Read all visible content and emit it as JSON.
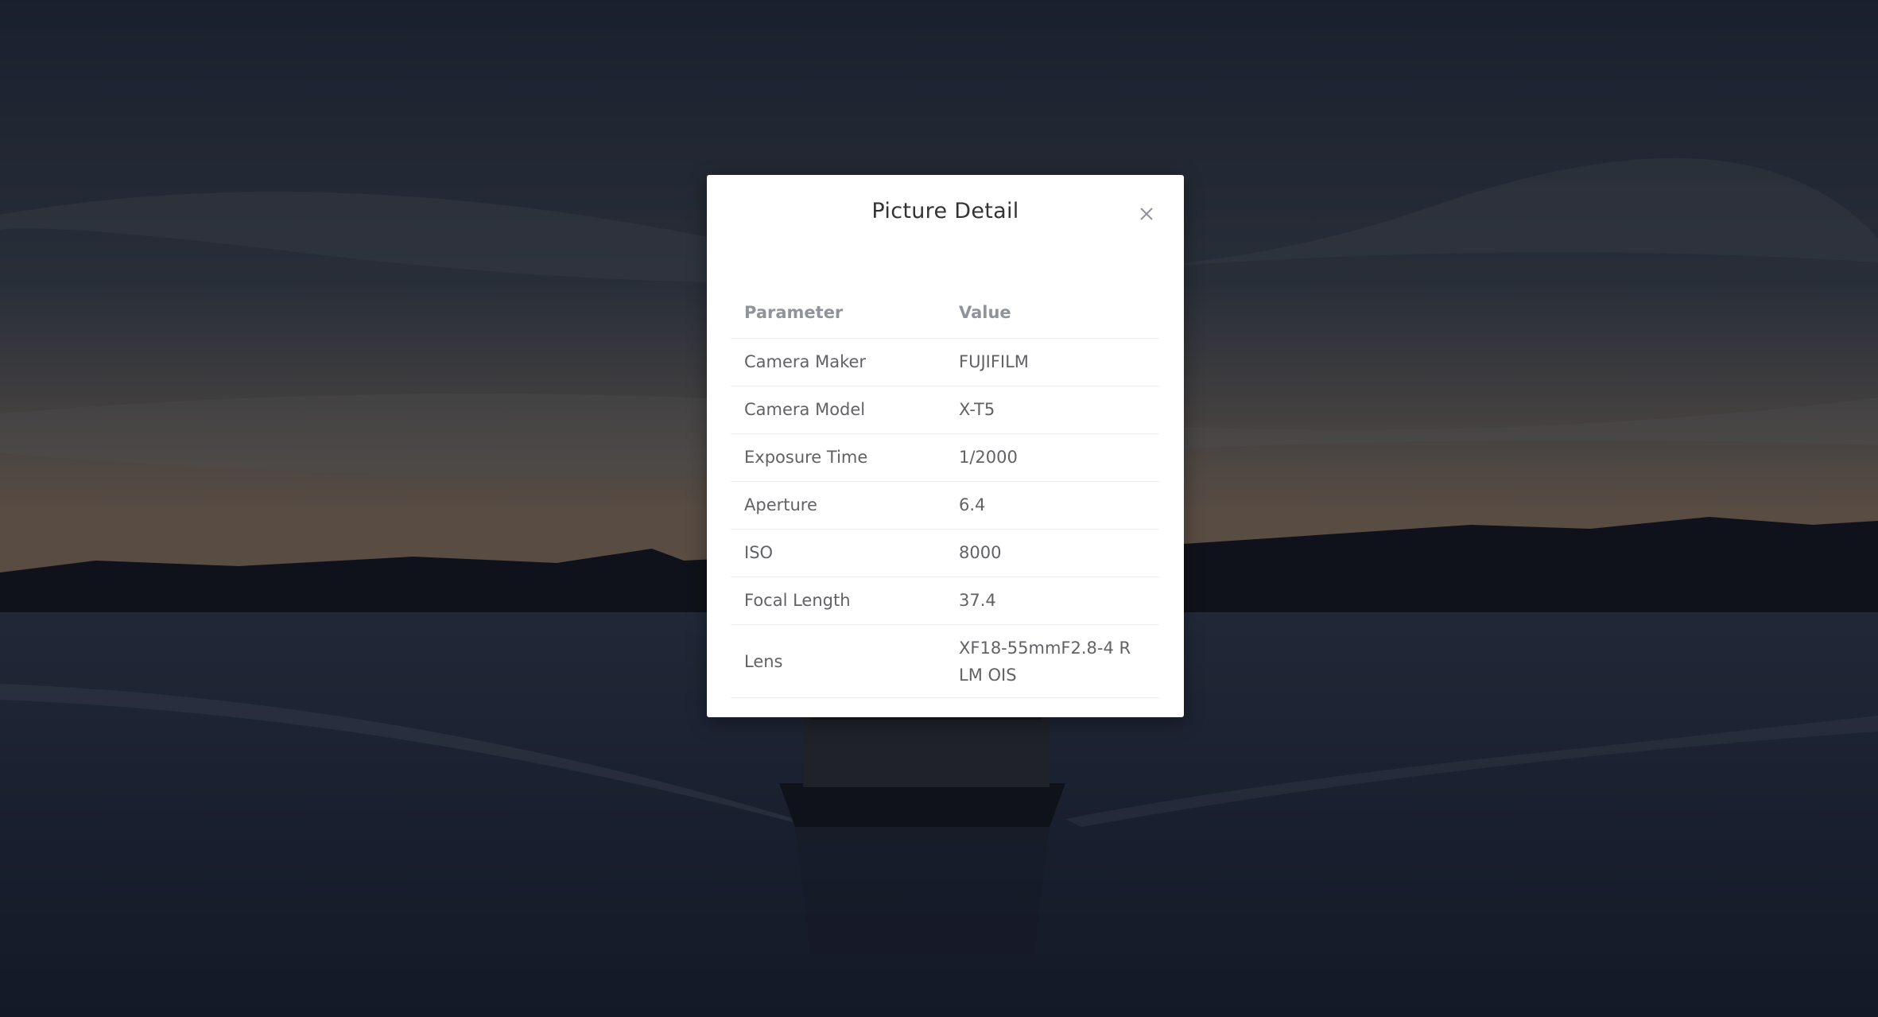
{
  "modal": {
    "title": "Picture Detail",
    "close_icon": "close-icon"
  },
  "table": {
    "headers": [
      "Parameter",
      "Value"
    ],
    "rows": [
      {
        "parameter": "Camera Maker",
        "value": "FUJIFILM"
      },
      {
        "parameter": "Camera Model",
        "value": "X-T5"
      },
      {
        "parameter": "Exposure Time",
        "value": "1/2000"
      },
      {
        "parameter": "Aperture",
        "value": "6.4"
      },
      {
        "parameter": "ISO",
        "value": "8000"
      },
      {
        "parameter": "Focal Length",
        "value": "37.4"
      },
      {
        "parameter": "Lens",
        "value": "XF18-55mmF2.8-4 R LM OIS"
      }
    ]
  }
}
